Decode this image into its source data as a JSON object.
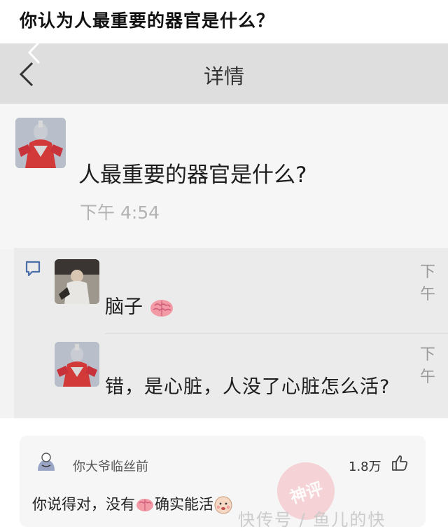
{
  "question": {
    "title": "你认为人最重要的器官是什么？"
  },
  "screenshot": {
    "header_title": "详情",
    "post": {
      "text": "人最重要的器官是什么?",
      "time": "下午 4:54"
    },
    "comments": [
      {
        "text": "脑子",
        "emoji": "brain-emoji",
        "time": "下午"
      },
      {
        "text": "错，是心脏，人没了心脏怎么活?",
        "time": "下午"
      }
    ]
  },
  "reply": {
    "username": "你大爷临丝前",
    "likes": "1.8万",
    "text_before": "你说得对，没有",
    "text_after": "确实能活",
    "emoji_1": "brain-emoji",
    "emoji_2": "face-emoji"
  },
  "watermark": {
    "seal": "神评",
    "text": "快传号 / 鱼儿的快"
  },
  "icons": {
    "back": "chevron-left-icon",
    "comment": "comment-bubble-icon",
    "like": "thumbs-up-icon"
  }
}
